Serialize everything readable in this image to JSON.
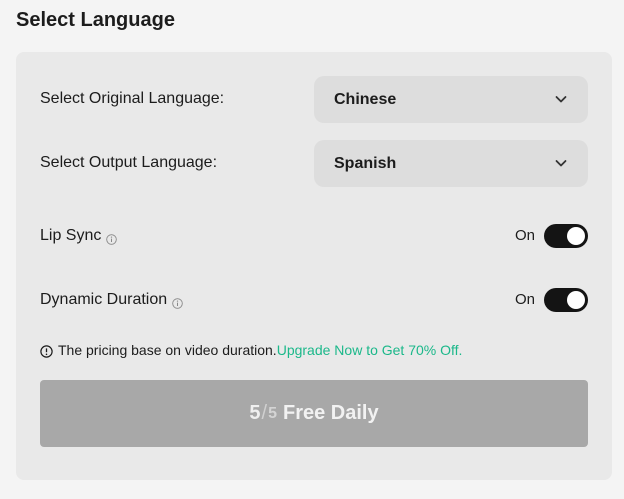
{
  "header": {
    "title": "Select Language"
  },
  "original_language": {
    "label": "Select Original Language:",
    "value": "Chinese"
  },
  "output_language": {
    "label": "Select Output Language:",
    "value": "Spanish"
  },
  "lip_sync": {
    "label": "Lip Sync",
    "state": "On",
    "enabled": true
  },
  "dynamic_duration": {
    "label": "Dynamic Duration",
    "state": "On",
    "enabled": true
  },
  "pricing_note": {
    "text": "The pricing base on video duration.",
    "link": "Upgrade Now to Get 70% Off."
  },
  "action": {
    "used": "5",
    "slash": "/",
    "total": "5",
    "label": "Free Daily"
  },
  "colors": {
    "link": "#1bb88a",
    "toggle_on": "#141414",
    "button_disabled": "#a8a8a8"
  },
  "icons": [
    "chevron-down-icon",
    "info-icon",
    "alert-info-icon"
  ]
}
